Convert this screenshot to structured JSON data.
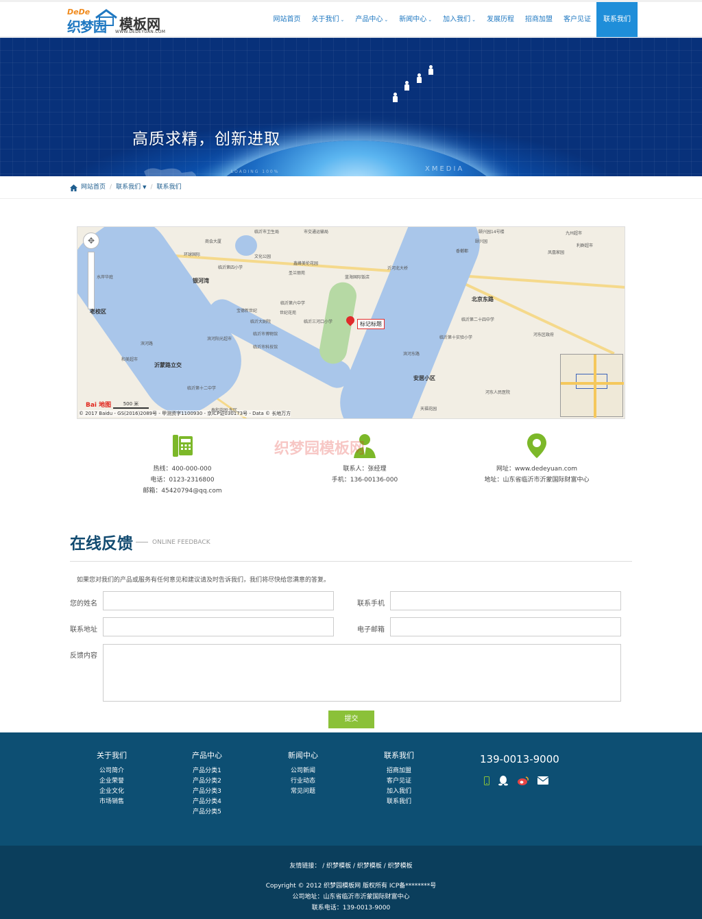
{
  "logo": {
    "dede": "DeDe",
    "zmy": "织梦园",
    "mbw": "模板网",
    "url": "WWW.DEDEYUAN.COM"
  },
  "nav": [
    {
      "label": "网站首页",
      "caret": false
    },
    {
      "label": "关于我们",
      "caret": true
    },
    {
      "label": "产品中心",
      "caret": true
    },
    {
      "label": "新闻中心",
      "caret": true
    },
    {
      "label": "加入我们",
      "caret": true
    },
    {
      "label": "发展历程",
      "caret": false
    },
    {
      "label": "招商加盟",
      "caret": false
    },
    {
      "label": "客户见证",
      "caret": false
    },
    {
      "label": "联系我们",
      "caret": false,
      "active": true
    }
  ],
  "banner": {
    "slogan": "高质求精，创新进取",
    "tag1": "LOADING 100%",
    "tag2": "XMEDIA"
  },
  "breadcrumb": {
    "home": "网站首页",
    "section": "联系我们",
    "current": "联系我们"
  },
  "map": {
    "marker_label": "标记标题",
    "copyright": "© 2017 Baidu - GS(2016)2089号 - 甲测资字1100930 - 京ICP证030173号 - Data © 长地万方",
    "scale": "500 米",
    "logo": "Bai 地图",
    "labels": [
      {
        "t": "临沂市卫生局"
      },
      {
        "t": "市交通运输局"
      },
      {
        "t": "颐兴园14号楼"
      },
      {
        "t": "九州超市"
      },
      {
        "t": "商会大厦"
      },
      {
        "t": "文化公园"
      },
      {
        "t": "环球国际"
      },
      {
        "t": "临沂第四小学"
      },
      {
        "t": "银河湾",
        "big": true
      },
      {
        "t": "水岸华庭"
      },
      {
        "t": "鑫峰美伦花园"
      },
      {
        "t": "沂河北大桥"
      },
      {
        "t": "圣兰丽苑"
      },
      {
        "t": "蓝海国际饭店"
      },
      {
        "t": "北京东路",
        "big": true
      },
      {
        "t": "临沂第六中学"
      },
      {
        "t": "颐兴园"
      },
      {
        "t": "香樾都"
      },
      {
        "t": "凤凰家园"
      },
      {
        "t": "宝德新世纪"
      },
      {
        "t": "临沂大剧院"
      },
      {
        "t": "临沂三河口小学"
      },
      {
        "t": "世纪花苑"
      },
      {
        "t": "临沂市博物馆"
      },
      {
        "t": "临沂市科技馆"
      },
      {
        "t": "滨河阳光超市"
      },
      {
        "t": "和美超市"
      },
      {
        "t": "沂蒙路立交",
        "big": true
      },
      {
        "t": "滨河路"
      },
      {
        "t": "临沂第二十四中学"
      },
      {
        "t": "河东区政府"
      },
      {
        "t": "安居小区",
        "big": true
      },
      {
        "t": "河东人民医院"
      },
      {
        "t": "天福花园"
      },
      {
        "t": "临沂第十二中学"
      },
      {
        "t": "泰和花园·东区"
      },
      {
        "t": "老校区",
        "big": true
      },
      {
        "t": "滨河东路"
      },
      {
        "t": "临沂第十实验小学"
      },
      {
        "t": "利群超市"
      }
    ]
  },
  "contacts": [
    {
      "lines": [
        "热线：400-000-000",
        "电话：0123-2316800",
        "邮箱：45420794@qq.com"
      ]
    },
    {
      "lines": [
        "联系人：张经理",
        "手机：136-00136-000"
      ]
    },
    {
      "lines": [
        "网址：www.dedeyuan.com",
        "地址：山东省临沂市沂蒙国际财富中心"
      ]
    }
  ],
  "watermark": "织梦园模板网",
  "feedback": {
    "title": "在线反馈",
    "subtitle": "ONLINE FEEDBACK",
    "desc": "如果您对我们的产品或服务有任何意见和建议请及时告诉我们，我们将尽快给您满意的答复。",
    "name_label": "您的姓名",
    "phone_label": "联系手机",
    "addr_label": "联系地址",
    "email_label": "电子邮箱",
    "content_label": "反馈内容",
    "submit": "提交"
  },
  "footer": {
    "cols": [
      {
        "title": "关于我们",
        "links": [
          "公司简介",
          "企业荣誉",
          "企业文化",
          "市场销售"
        ]
      },
      {
        "title": "产品中心",
        "links": [
          "产品分类1",
          "产品分类2",
          "产品分类3",
          "产品分类4",
          "产品分类5"
        ]
      },
      {
        "title": "新闻中心",
        "links": [
          "公司新闻",
          "行业动态",
          "常见问题"
        ]
      },
      {
        "title": "联系我们",
        "links": [
          "招商加盟",
          "客户见证",
          "加入我们",
          "联系我们"
        ]
      }
    ],
    "phone": "139-0013-9000",
    "links_label": "友情链接：",
    "friend_links": [
      "织梦模板",
      "织梦模板",
      "织梦模板"
    ],
    "copyright": "Copyright © 2012 织梦园模板网 版权所有 ICP备********号",
    "address": "公司地址：山东省临沂市沂蒙国际财富中心",
    "tel": "联系电话：139-0013-9000"
  },
  "colors": {
    "brand": "#1f78c1",
    "nav_active": "#1f8ed9",
    "footer": "#0d4f73",
    "footer_bottom": "#0b3e5c",
    "submit": "#8bc139",
    "icon_green": "#7cb829"
  }
}
